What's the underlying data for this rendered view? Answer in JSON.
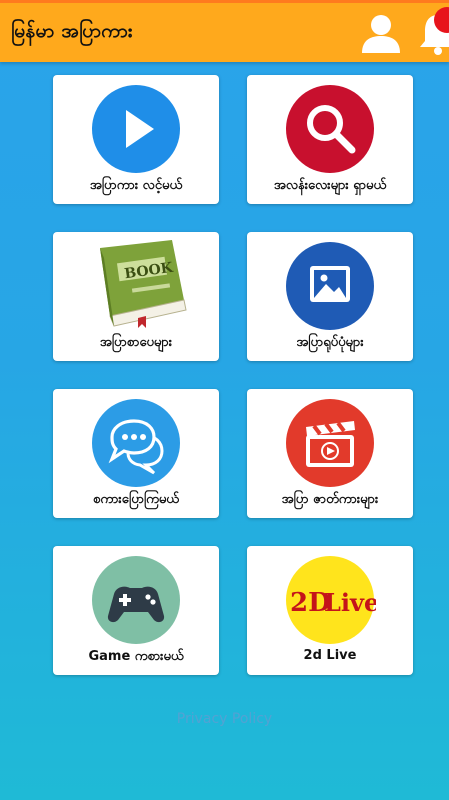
{
  "app": {
    "title": "မြန်မာ အပြာကား"
  },
  "header": {
    "badge_count": ""
  },
  "menu": [
    {
      "label": "အပြာကား လင့်မယ်",
      "icon": "play-icon"
    },
    {
      "label": "အလန်းလေးများ ရှာမယ်",
      "icon": "search-icon"
    },
    {
      "label": "အပြာစာပေများ",
      "icon": "book-icon"
    },
    {
      "label": "အပြာရုပ်ပုံများ",
      "icon": "image-icon"
    },
    {
      "label": "စကားပြောကြမယ်",
      "icon": "chat-icon"
    },
    {
      "label": "အပြာ ဇာတ်ကားများ",
      "icon": "video-clapper-icon"
    },
    {
      "label": "Game ကစားမယ်",
      "icon": "gamepad-icon"
    },
    {
      "label": "2d Live",
      "icon": "2d-live-icon"
    }
  ],
  "book_icon_text": "BOOK",
  "live_icon_text": {
    "left": "2D",
    "right": "Live"
  },
  "footer": {
    "privacy_label": "Privacy Policy"
  },
  "colors": {
    "appbar": "#ffa91c",
    "background_top": "#2aa3ea",
    "background_bottom": "#1fbad6",
    "play": "#1f8ee8",
    "search": "#c8102e",
    "image": "#1f5bb5",
    "chat": "#2c9ce6",
    "video": "#e23a2b",
    "gamepad": "#7fbfa5",
    "live": "#ffe41c",
    "badge": "#e7141c"
  }
}
